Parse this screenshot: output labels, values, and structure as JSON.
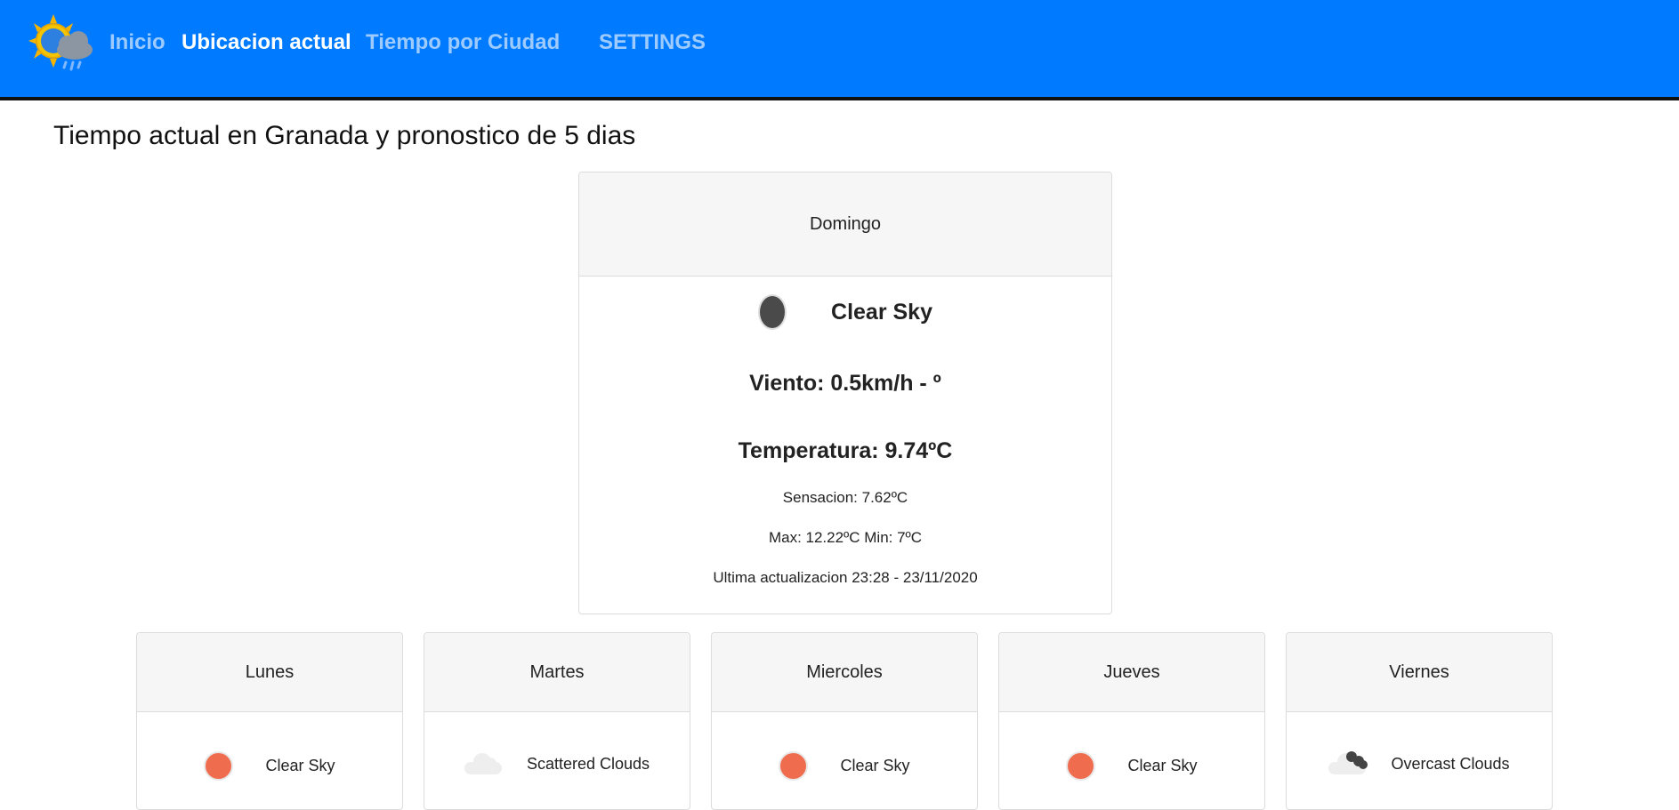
{
  "nav": {
    "logo_icon": "sun-cloud-rain-icon",
    "links": [
      "Inicio",
      "Ubicacion actual",
      "Tiempo por Ciudad",
      "SETTINGS"
    ],
    "active": "Ubicacion actual"
  },
  "page": {
    "heading": "Tiempo actual en Granada y pronostico de 5 dias"
  },
  "current": {
    "day": "Domingo",
    "icon": "moon-icon",
    "description": "Clear Sky",
    "wind": "Viento: 0.5km/h - º",
    "temperature": "Temperatura: 9.74ºC",
    "feels_like": "Sensacion: 7.62ºC",
    "max_min": "Max: 12.22ºC Min: 7ºC",
    "updated": "Ultima actualizacion 23:28 - 23/11/2020"
  },
  "forecast": [
    {
      "day": "Lunes",
      "icon": "sun-icon",
      "description": "Clear Sky"
    },
    {
      "day": "Martes",
      "icon": "cloud-icon",
      "description": "Scattered Clouds"
    },
    {
      "day": "Miercoles",
      "icon": "sun-icon",
      "description": "Clear Sky"
    },
    {
      "day": "Jueves",
      "icon": "sun-icon",
      "description": "Clear Sky"
    },
    {
      "day": "Viernes",
      "icon": "overcast-cloud-icon",
      "description": "Overcast Clouds"
    }
  ],
  "colors": {
    "navbar": "#007bff",
    "nav_link": "#9ecbff",
    "nav_active": "#ffffff",
    "sun": "#ef6c4f"
  }
}
